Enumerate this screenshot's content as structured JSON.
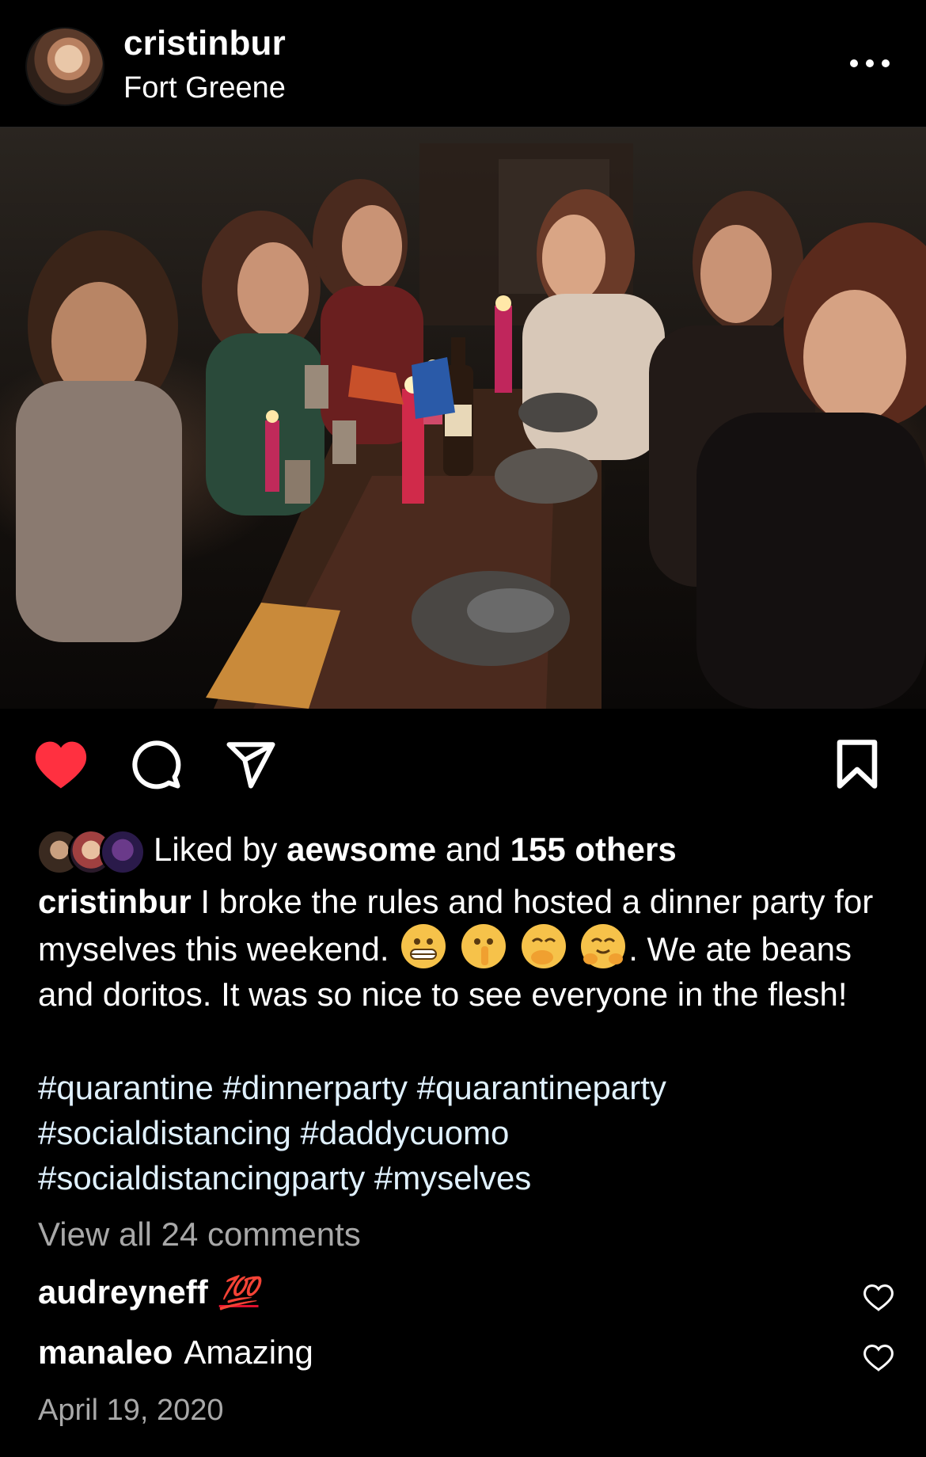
{
  "post": {
    "username": "cristinbur",
    "location": "Fort Greene",
    "likes": {
      "prefix": "Liked by",
      "liker": "aewsome",
      "joiner": "and",
      "others": "155 others"
    },
    "caption": {
      "username": "cristinbur",
      "text_1": "I broke the rules and hosted a dinner party for myselves this weekend.",
      "text_2": ". We ate beans and doritos. It was so nice to see everyone  in the flesh!",
      "emojis": [
        "grimacing-face",
        "shushing-face",
        "hand-over-mouth-face",
        "hugging-face"
      ]
    },
    "hashtags": [
      "#quarantine",
      "#dinnerparty",
      "#quarantineparty",
      "#socialdistancing",
      "#daddycuomo",
      "#socialdistancingparty",
      "#myselves"
    ],
    "view_all_comments": "View all 24 comments",
    "comments": [
      {
        "username": "audreyneff",
        "text": "💯"
      },
      {
        "username": "manaleo",
        "text": "Amazing"
      }
    ],
    "date": "April 19, 2020",
    "liked": true,
    "colors": {
      "like_red": "#ff3040",
      "hashtag": "#e0f1ff",
      "muted": "#a8a8a8"
    }
  }
}
